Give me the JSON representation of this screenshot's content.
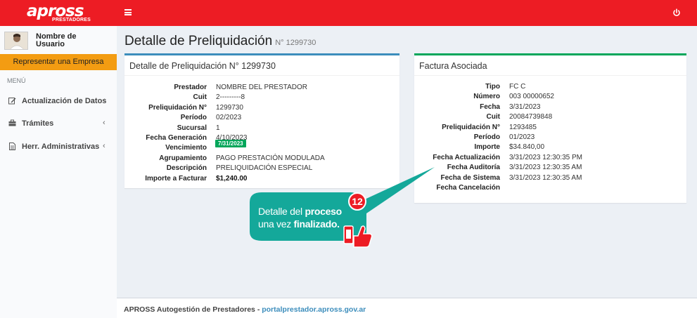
{
  "header": {
    "logo_text": "apross",
    "logo_subtext": "PRESTADORES",
    "menu_icon": "hamburger-icon",
    "power_icon": "power-icon",
    "brand_color": "#ed1c24"
  },
  "sidebar": {
    "user_name": "Nombre de Usuario",
    "empresa_button": "Representar una Empresa",
    "menu_header": "MENÚ",
    "items": [
      {
        "label": "Actualización de Datos",
        "icon": "edit-icon"
      },
      {
        "label": "Trámites",
        "icon": "briefcase-icon"
      },
      {
        "label": "Herr. Administrativas",
        "icon": "document-icon"
      }
    ],
    "accent_color": "#f39c12"
  },
  "page": {
    "title": "Detalle de Preliquidación",
    "subtitle": "N° 1299730"
  },
  "left_panel": {
    "title": "Detalle de Preliquidación N° 1299730",
    "rows": [
      {
        "label": "Prestador",
        "value": "NOMBRE DEL PRESTADOR"
      },
      {
        "label": "Cuit",
        "value": "2---------8"
      },
      {
        "label": "Preliquidación N°",
        "value": "1299730"
      },
      {
        "label": "Período",
        "value": "02/2023"
      },
      {
        "label": "Sucursal",
        "value": "1"
      },
      {
        "label": "Fecha Generación",
        "value": "4/10/2023"
      },
      {
        "label": "Vencimiento",
        "value": "7/31/2023"
      },
      {
        "label": "Agrupamiento",
        "value": "PAGO PRESTACIÓN MODULADA"
      },
      {
        "label": "Descripción",
        "value": "PRELIQUIDACIÓN ESPECIAL"
      },
      {
        "label": "Importe a Facturar",
        "value": "$1,240.00"
      }
    ]
  },
  "right_panel": {
    "title": "Factura Asociada",
    "rows": [
      {
        "label": "Tipo",
        "value": "FC C"
      },
      {
        "label": "Número",
        "value": "003 00000652"
      },
      {
        "label": "Fecha",
        "value": "3/31/2023"
      },
      {
        "label": "Cuit",
        "value": "20084739848"
      },
      {
        "label": "Preliquidación N°",
        "value": "1293485"
      },
      {
        "label": "Período",
        "value": "01/2023"
      },
      {
        "label": "Importe",
        "value": "$34.840,00"
      },
      {
        "label": "Fecha Actualización",
        "value": "3/31/2023 12:30:35 PM"
      },
      {
        "label": "Fecha Auditoría",
        "value": "3/31/2023 12:30:35 AM"
      },
      {
        "label": "Fecha de Sistema",
        "value": "3/31/2023 12:30:35 AM"
      },
      {
        "label": "Fecha Cancelación",
        "value": ""
      }
    ]
  },
  "footer": {
    "text": "APROSS Autogestión de Prestadores - ",
    "link": "portalprestador.apross.gov.ar"
  },
  "callout": {
    "step": "12",
    "line1_a": "Detalle del ",
    "line1_b": "proceso",
    "line2_a": "una vez ",
    "line2_b": "finalizado.",
    "color": "#14a89a"
  }
}
